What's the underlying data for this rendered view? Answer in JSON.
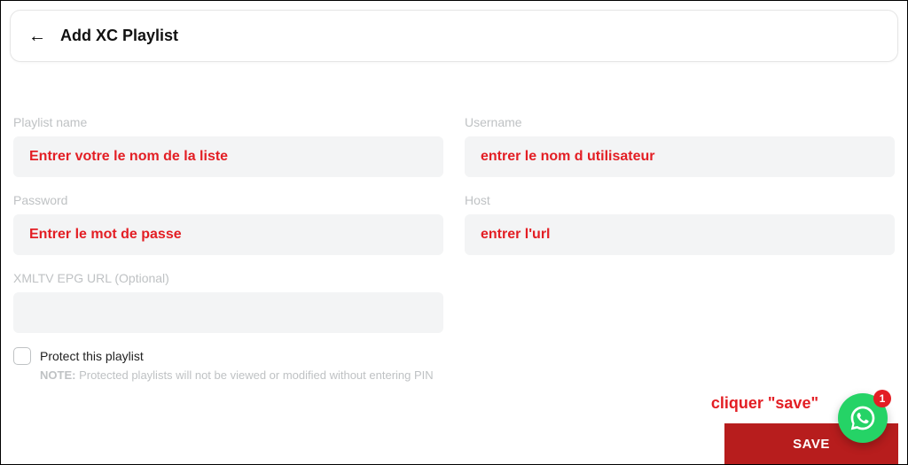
{
  "header": {
    "title": "Add XC Playlist"
  },
  "fields": {
    "playlistName": {
      "label": "Playlist name",
      "value": "Entrer votre le nom de la liste"
    },
    "username": {
      "label": "Username",
      "value": "entrer le nom d utilisateur"
    },
    "password": {
      "label": "Password",
      "value": "Entrer le mot de passe"
    },
    "host": {
      "label": "Host",
      "value": "entrer l'url"
    },
    "xmltv": {
      "label": "XMLTV EPG URL (Optional)",
      "value": ""
    }
  },
  "protect": {
    "label": "Protect this playlist",
    "notePrefix": "NOTE:",
    "noteText": " Protected playlists will not be viewed or modified without entering PIN"
  },
  "annotations": {
    "saveHint": "cliquer \"save\""
  },
  "saveButton": "SAVE",
  "fab": {
    "badge": "1"
  }
}
